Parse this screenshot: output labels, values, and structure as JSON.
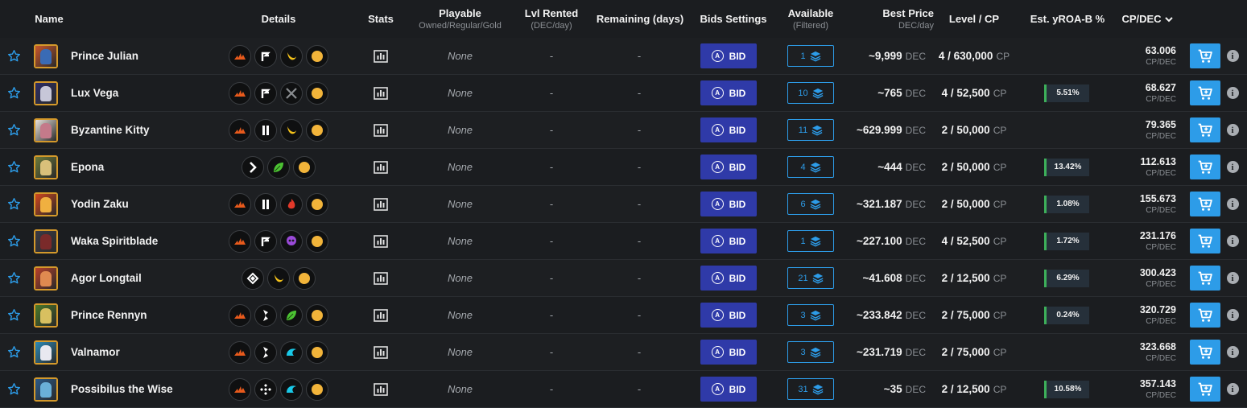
{
  "header": {
    "name": "Name",
    "details": "Details",
    "stats": "Stats",
    "playable": "Playable",
    "playable_sub": "Owned/Regular/Gold",
    "lvl_rented": "Lvl Rented",
    "lvl_rented_sub": "(DEC/day)",
    "remaining": "Remaining (days)",
    "bids_settings": "Bids Settings",
    "available": "Available",
    "available_sub": "(Filtered)",
    "best_price": "Best Price",
    "best_price_sub": "DEC/day",
    "level_cp": "Level / CP",
    "yroa": "Est. yROA-B %",
    "cpdec": "CP/DEC",
    "sort_icon": "chevron-down-icon"
  },
  "labels": {
    "bid": "BID",
    "dec": "DEC",
    "cp": "CP",
    "cpdec_unit": "CP/DEC",
    "info": "i"
  },
  "colors": {
    "accent_blue": "#2d9ce8",
    "bid_button": "#2f3aa8",
    "yroa_accent": "#3db05a",
    "avatar_border": "#d4992b"
  },
  "rows": [
    {
      "name": "Prince Julian",
      "icons": [
        "fire",
        "arrow-turn",
        "gold-crescent",
        "gold-coin"
      ],
      "playable": "None",
      "lvl": "-",
      "remaining": "-",
      "available": "1",
      "price": "~9,999",
      "level": "4 / 630,000",
      "yroa": "",
      "cpdec": "63.006",
      "avatar_colors": [
        "#c8562b",
        "#3a6bb5"
      ]
    },
    {
      "name": "Lux Vega",
      "icons": [
        "fire",
        "arrow-turn",
        "crossed-swords",
        "gold-coin"
      ],
      "playable": "None",
      "lvl": "-",
      "remaining": "-",
      "available": "10",
      "price": "~765",
      "level": "4 / 52,500",
      "yroa": "5.51%",
      "cpdec": "68.627",
      "avatar_colors": [
        "#2b2d66",
        "#c7c7d8"
      ]
    },
    {
      "name": "Byzantine Kitty",
      "icons": [
        "fire",
        "double-bar",
        "gold-crescent",
        "gold-coin"
      ],
      "playable": "None",
      "lvl": "-",
      "remaining": "-",
      "available": "11",
      "price": "~629.999",
      "level": "2 / 50,000",
      "yroa": "",
      "cpdec": "79.365",
      "avatar_colors": [
        "#e8e2dc",
        "#c47a8a"
      ]
    },
    {
      "name": "Epona",
      "icons": [
        "chevron-right",
        "green-leaf",
        "gold-coin"
      ],
      "playable": "None",
      "lvl": "-",
      "remaining": "-",
      "available": "4",
      "price": "~444",
      "level": "2 / 50,000",
      "yroa": "13.42%",
      "cpdec": "112.613",
      "avatar_colors": [
        "#6b7a3a",
        "#d9c07a"
      ]
    },
    {
      "name": "Yodin Zaku",
      "icons": [
        "fire",
        "double-bar",
        "red-flame",
        "gold-coin"
      ],
      "playable": "None",
      "lvl": "-",
      "remaining": "-",
      "available": "6",
      "price": "~321.187",
      "level": "2 / 50,000",
      "yroa": "1.08%",
      "cpdec": "155.673",
      "avatar_colors": [
        "#d0461e",
        "#f0b040"
      ]
    },
    {
      "name": "Waka Spiritblade",
      "icons": [
        "fire",
        "arrow-turn",
        "purple-skull",
        "gold-coin"
      ],
      "playable": "None",
      "lvl": "-",
      "remaining": "-",
      "available": "1",
      "price": "~227.100",
      "level": "4 / 52,500",
      "yroa": "1.72%",
      "cpdec": "231.176",
      "avatar_colors": [
        "#3a3a45",
        "#7a2a2a"
      ]
    },
    {
      "name": "Agor Longtail",
      "icons": [
        "diamond-arrows",
        "gold-crescent",
        "gold-coin"
      ],
      "playable": "None",
      "lvl": "-",
      "remaining": "-",
      "available": "21",
      "price": "~41.608",
      "level": "2 / 12,500",
      "yroa": "6.29%",
      "cpdec": "300.423",
      "avatar_colors": [
        "#b8402a",
        "#e08a50"
      ]
    },
    {
      "name": "Prince Rennyn",
      "icons": [
        "fire",
        "lightning-b",
        "green-leaf",
        "gold-coin"
      ],
      "playable": "None",
      "lvl": "-",
      "remaining": "-",
      "available": "3",
      "price": "~233.842",
      "level": "2 / 75,000",
      "yroa": "0.24%",
      "cpdec": "320.729",
      "avatar_colors": [
        "#4a7a2a",
        "#d8c060"
      ]
    },
    {
      "name": "Valnamor",
      "icons": [
        "fire",
        "lightning-b",
        "cyan-wave",
        "gold-coin"
      ],
      "playable": "None",
      "lvl": "-",
      "remaining": "-",
      "available": "3",
      "price": "~231.719",
      "level": "2 / 75,000",
      "yroa": "",
      "cpdec": "323.668",
      "avatar_colors": [
        "#2a8ab8",
        "#e8e8f0"
      ]
    },
    {
      "name": "Possibilus the Wise",
      "icons": [
        "fire",
        "four-diamonds",
        "cyan-wave",
        "gold-coin"
      ],
      "playable": "None",
      "lvl": "-",
      "remaining": "-",
      "available": "31",
      "price": "~35",
      "level": "2 / 12,500",
      "yroa": "10.58%",
      "cpdec": "357.143",
      "avatar_colors": [
        "#2a5a8a",
        "#6ab0d8"
      ]
    }
  ]
}
